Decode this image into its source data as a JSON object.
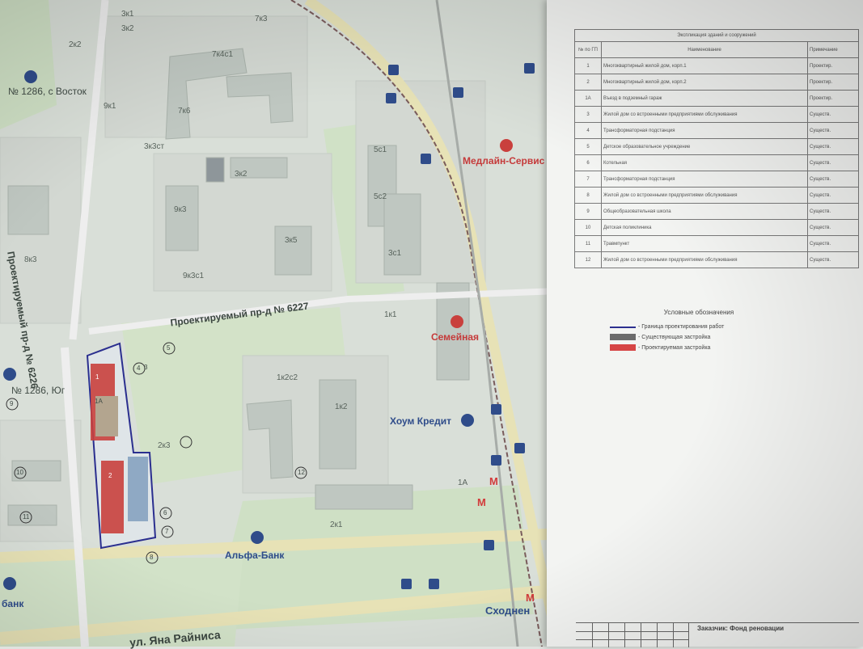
{
  "map": {
    "streets": [
      "Проектируемый пр-д № 6227",
      "Проектируемый пр-д № 6226",
      "ул. Яна Райниса"
    ],
    "pois": [
      {
        "name": "Медлайн-Сервис",
        "color": "#c53a3a"
      },
      {
        "name": "Семейная",
        "color": "#c53a3a"
      },
      {
        "name": "Хоум Кредит",
        "color": "#2f4c8a"
      },
      {
        "name": "Альфа-Банк",
        "color": "#2f4c8a"
      },
      {
        "name": "Сходнен",
        "color": "#2f4c8a"
      },
      {
        "name": "банк",
        "color": "#2f4c8a"
      }
    ],
    "stops": [
      "№ 1286, с Восток",
      "№ 1286, Юг"
    ],
    "buildings": [
      "3к1",
      "3к2",
      "2к2",
      "7к3",
      "7к4с1",
      "9к1",
      "3к3ст",
      "3к2",
      "7к6",
      "9к3",
      "3к5",
      "9к3с1",
      "5с1",
      "5с2",
      "3с1",
      "1к1",
      "1к2с2",
      "1к2",
      "2к3",
      "2к1",
      "1А",
      "8к3"
    ],
    "plan_numbers": [
      "1",
      "1А",
      "2",
      "3",
      "4",
      "5",
      "6",
      "7",
      "8",
      "9",
      "10",
      "11",
      "12"
    ]
  },
  "sheet": {
    "table": {
      "caption": "Экспликация зданий и сооружений",
      "headers": {
        "num": "№ по ГП",
        "name": "Наименование",
        "status": "Примечание"
      },
      "rows": [
        {
          "n": "1",
          "name": "Многоквартирный жилой дом, корп.1",
          "status": "Проектир."
        },
        {
          "n": "2",
          "name": "Многоквартирный жилой дом, корп.2",
          "status": "Проектир."
        },
        {
          "n": "1А",
          "name": "Въезд в подземный гараж",
          "status": "Проектир."
        },
        {
          "n": "3",
          "name": "Жилой дом со встроенными предприятиями обслуживания",
          "status": "Существ."
        },
        {
          "n": "4",
          "name": "Трансформаторная подстанция",
          "status": "Существ."
        },
        {
          "n": "5",
          "name": "Детское образовательное учреждение",
          "status": "Существ."
        },
        {
          "n": "6",
          "name": "Котельная",
          "status": "Существ."
        },
        {
          "n": "7",
          "name": "Трансформаторная подстанция",
          "status": "Существ."
        },
        {
          "n": "8",
          "name": "Жилой дом со встроенными предприятиями обслуживания",
          "status": "Существ."
        },
        {
          "n": "9",
          "name": "Общеобразовательная школа",
          "status": "Существ."
        },
        {
          "n": "10",
          "name": "Детская поликлиника",
          "status": "Существ."
        },
        {
          "n": "11",
          "name": "Травмпункт",
          "status": "Существ."
        },
        {
          "n": "12",
          "name": "Жилой дом со встроенными предприятиями обслуживания",
          "status": "Существ."
        }
      ]
    },
    "legend": {
      "title": "Условные обозначения",
      "items": [
        {
          "label": "- Граница проектирования работ",
          "color": "#2b2f8f",
          "kind": "line"
        },
        {
          "label": "- Существующая застройка",
          "color": "#6b6b6b",
          "kind": "fill"
        },
        {
          "label": "- Проектируемая застройка",
          "color": "#d64545",
          "kind": "fill"
        }
      ]
    },
    "stamp": {
      "org": "Заказчик: Фонд реновации"
    }
  },
  "colors": {
    "road": "#e9e4b8",
    "park": "#cfe0c5",
    "block": "#d7dcd6",
    "building": "#bcc4bf",
    "rail": "#7a5c5c"
  }
}
